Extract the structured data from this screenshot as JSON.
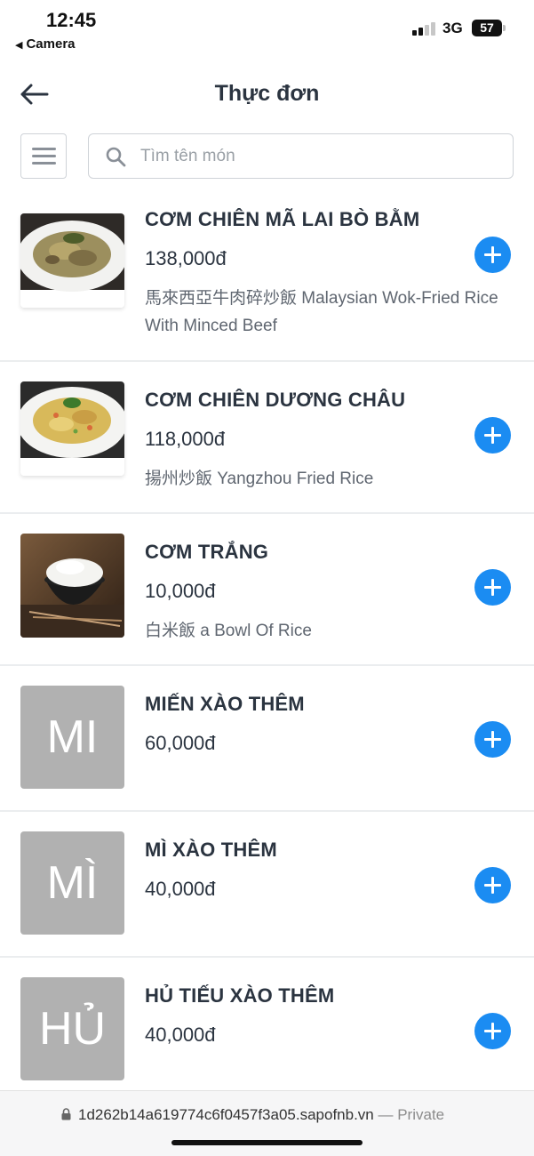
{
  "status_bar": {
    "time": "12:45",
    "back_app": "Camera",
    "network": "3G",
    "battery": "57"
  },
  "header": {
    "title": "Thực đơn"
  },
  "search": {
    "placeholder": "Tìm tên món",
    "value": ""
  },
  "menu_items": [
    {
      "name": "CƠM CHIÊN MÃ LAI BÒ BẰM",
      "price": "138,000đ",
      "description": "馬來西亞牛肉碎炒飯 Malaysian Wok-Fried Rice With Minced Beef",
      "thumbnail": "photo-fried-rice-beef",
      "thumb_text": ""
    },
    {
      "name": "CƠM CHIÊN DƯƠNG CHÂU",
      "price": "118,000đ",
      "description": "揚州炒飯 Yangzhou Fried Rice",
      "thumbnail": "photo-yangzhou-fried-rice",
      "thumb_text": ""
    },
    {
      "name": "CƠM TRẮNG",
      "price": "10,000đ",
      "description": "白米飯 a Bowl Of Rice",
      "thumbnail": "photo-bowl-of-rice",
      "thumb_text": ""
    },
    {
      "name": "MIẾN XÀO THÊM",
      "price": "60,000đ",
      "description": "",
      "thumbnail": "placeholder",
      "thumb_text": "MI"
    },
    {
      "name": "MÌ XÀO THÊM",
      "price": "40,000đ",
      "description": "",
      "thumbnail": "placeholder",
      "thumb_text": "MÌ"
    },
    {
      "name": "HỦ TIẾU XÀO THÊM",
      "price": "40,000đ",
      "description": "",
      "thumbnail": "placeholder",
      "thumb_text": "HỦ"
    }
  ],
  "url_bar": {
    "url": "1d262b14a619774c6f0457f3a05.sapofnb.vn",
    "suffix": "— Private"
  },
  "colors": {
    "accent": "#1b8cf2",
    "placeholder_thumb": "#b1b1b1",
    "text": "#2b3440"
  }
}
